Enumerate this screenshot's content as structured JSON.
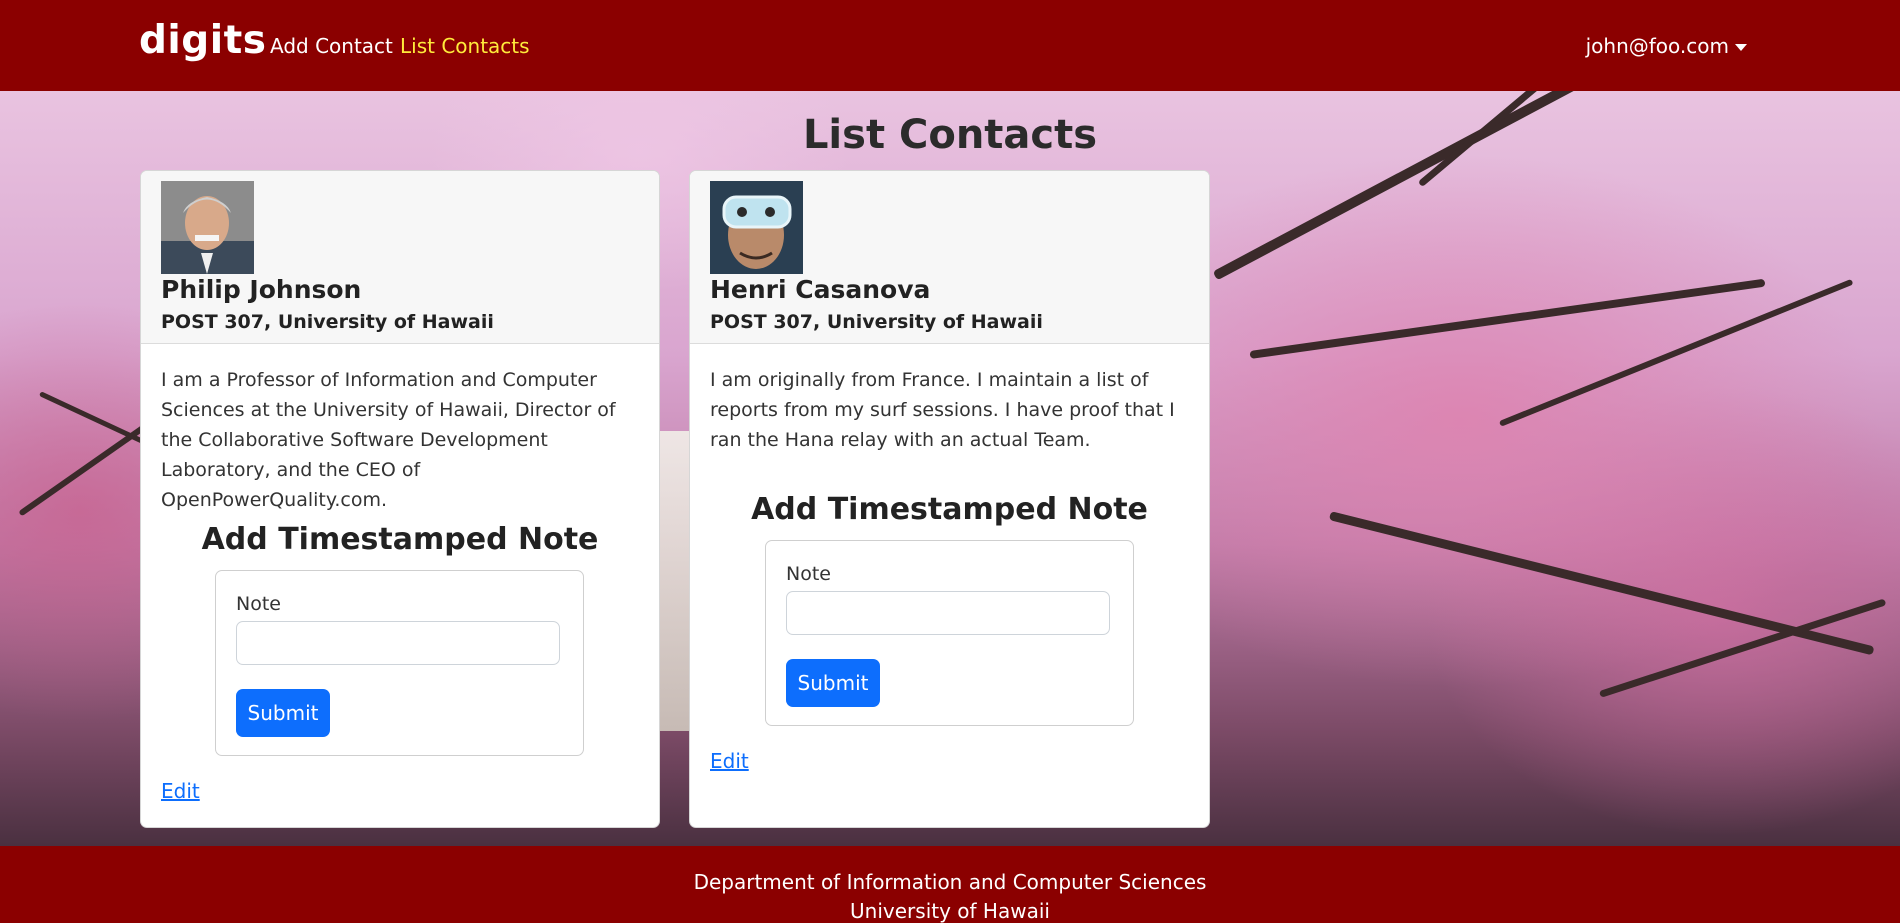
{
  "navbar": {
    "brand": "digits",
    "links": [
      {
        "label": "Add Contact",
        "active": false
      },
      {
        "label": "List Contacts",
        "active": true
      }
    ],
    "user": "john@foo.com"
  },
  "page": {
    "title": "List Contacts"
  },
  "contacts": [
    {
      "name": "Philip Johnson",
      "address": "POST 307, University of Hawaii",
      "bio": "I am a Professor of Information and Computer Sciences at the University of Hawaii, Director of the Collaborative Software Development Laboratory, and the CEO of OpenPowerQuality.com.",
      "note_form": {
        "title": "Add Timestamped Note",
        "label": "Note",
        "value": "",
        "submit": "Submit"
      },
      "edit": "Edit"
    },
    {
      "name": "Henri Casanova",
      "address": "POST 307, University of Hawaii",
      "bio": "I am originally from France. I maintain a list of reports from my surf sessions. I have proof that I ran the Hana relay with an actual Team.",
      "note_form": {
        "title": "Add Timestamped Note",
        "label": "Note",
        "value": "",
        "submit": "Submit"
      },
      "edit": "Edit"
    }
  ],
  "footer": {
    "line1": "Department of Information and Computer Sciences",
    "line2": "University of Hawaii"
  },
  "colors": {
    "navbar_bg": "#8b0000",
    "active_link": "#ffeb3b",
    "primary_button": "#0d6efd"
  }
}
